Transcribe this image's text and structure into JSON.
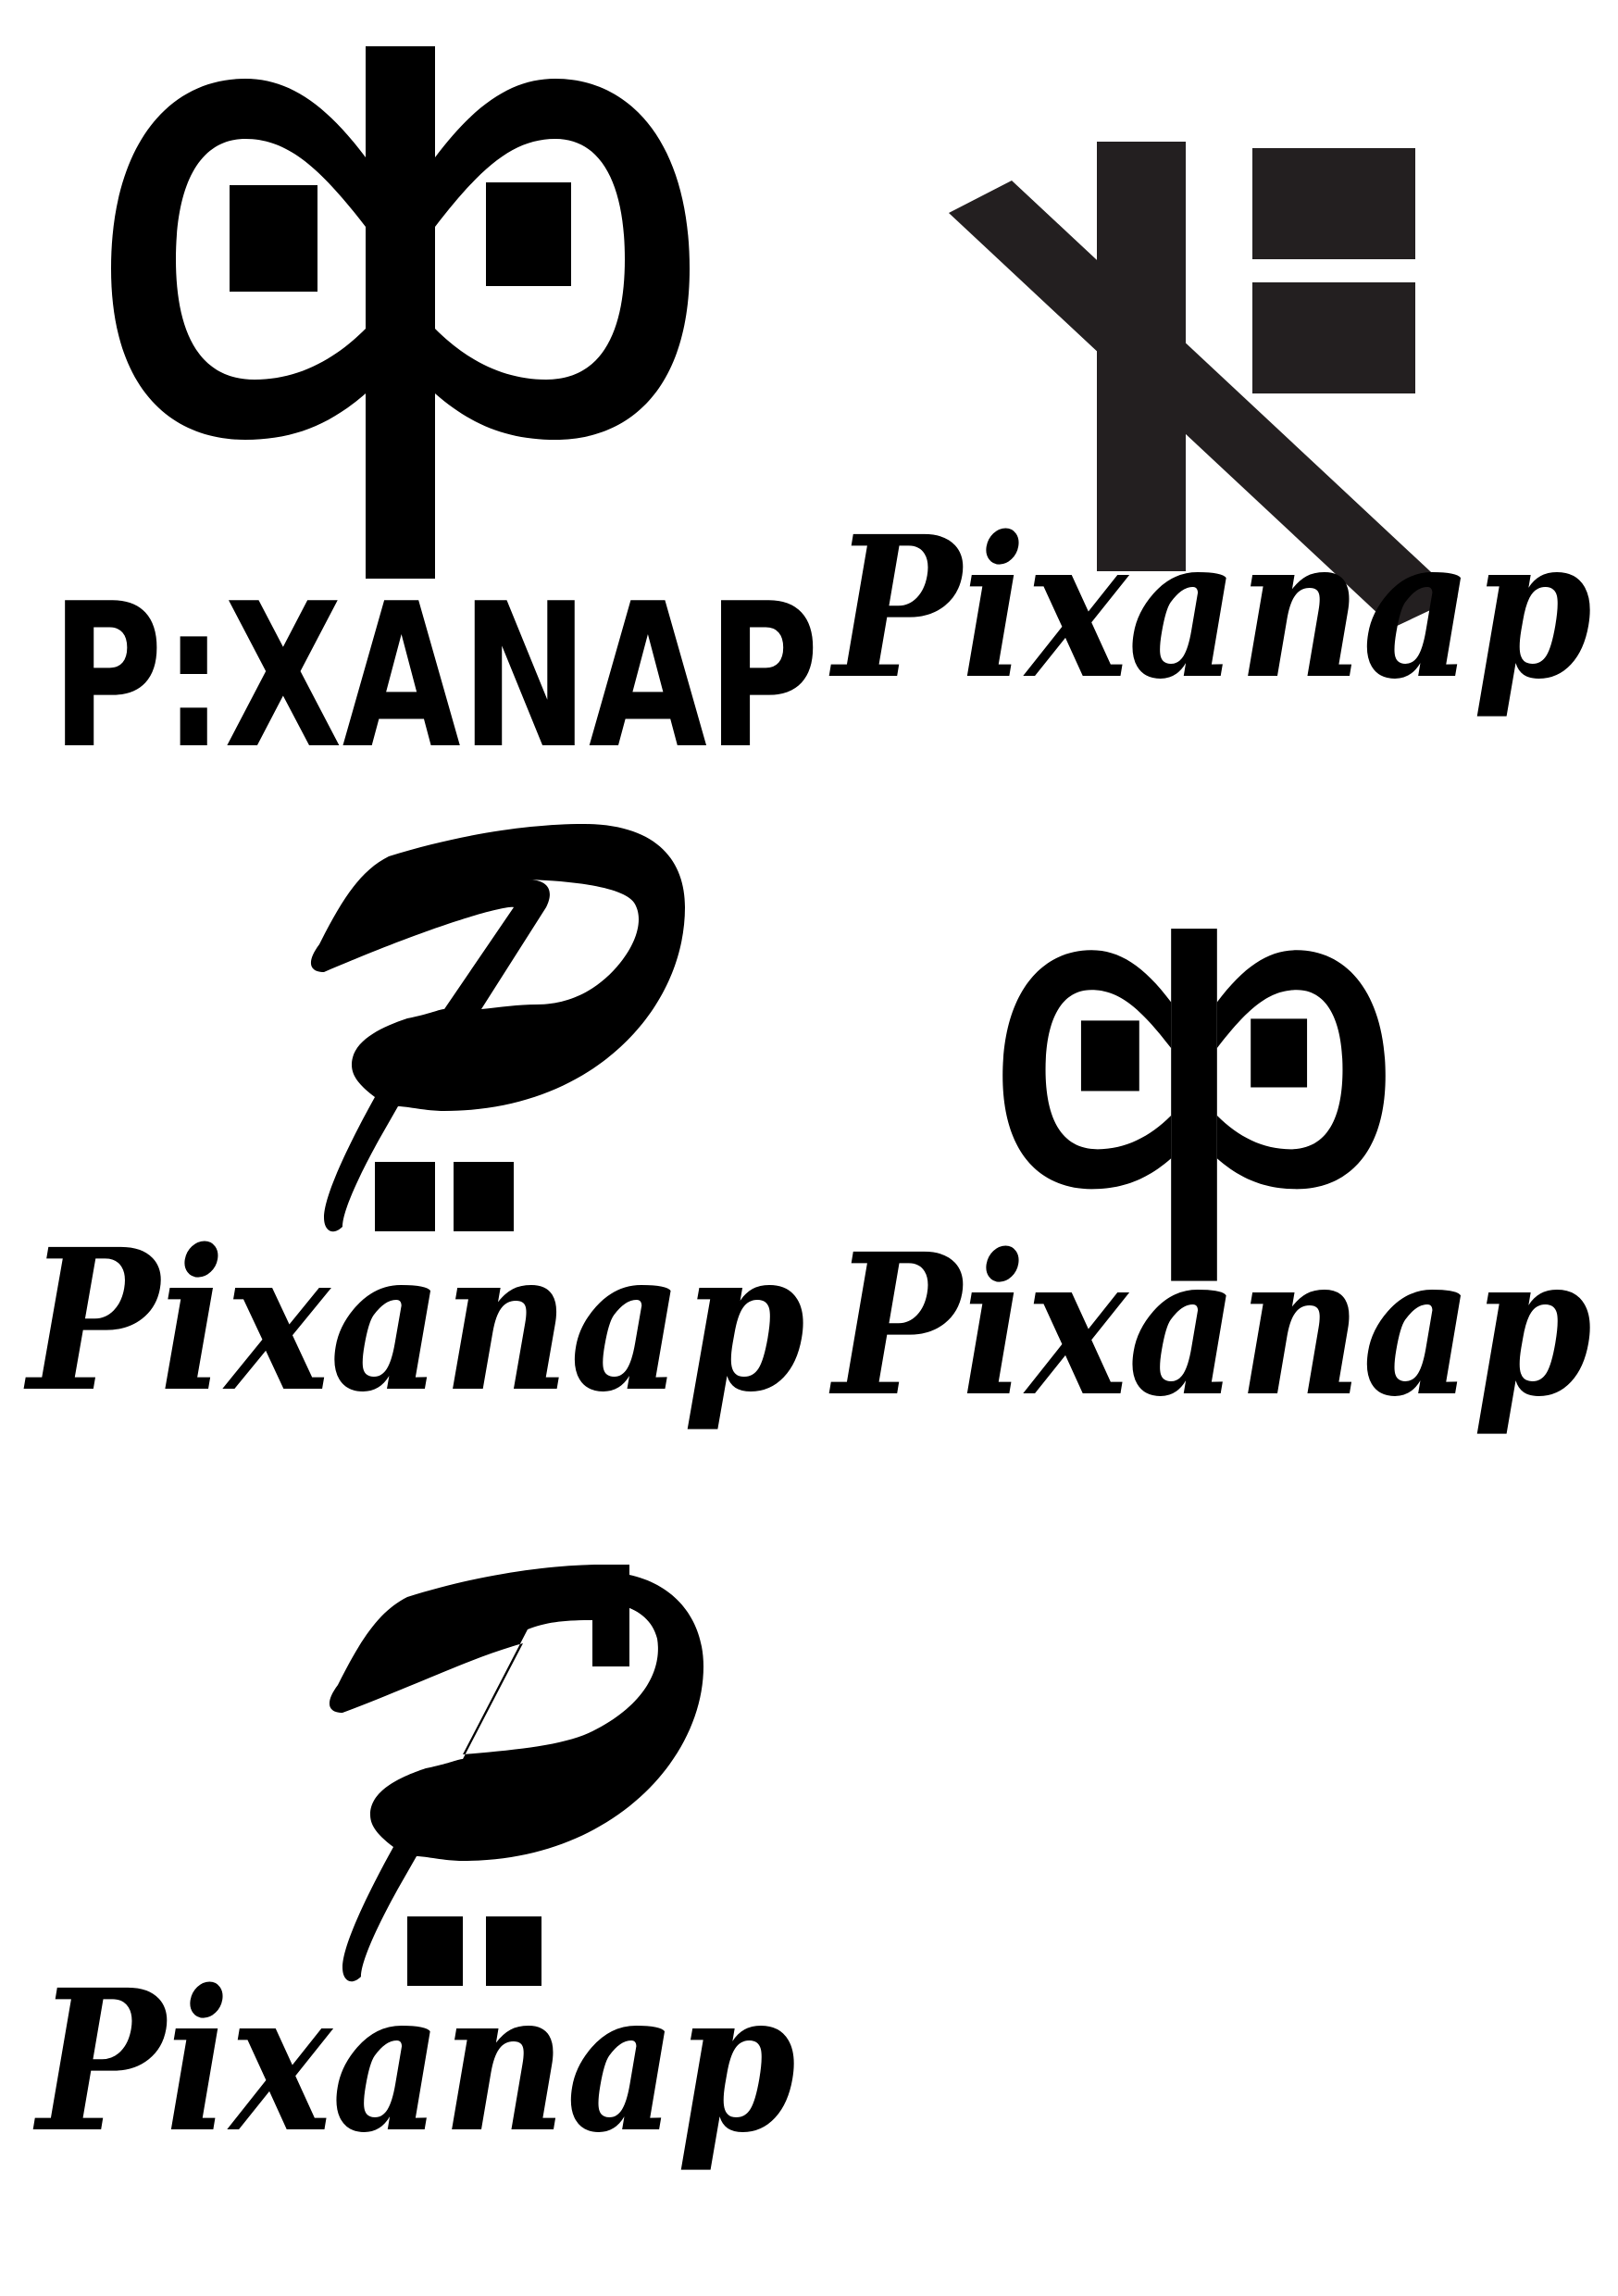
{
  "sheet": {
    "background": "#ffffff",
    "ink": "#000000",
    "ink_alt": "#231f20"
  },
  "logos": [
    {
      "id": "phi-block-wordmark",
      "mark": "phi-symbol-with-square-eyes",
      "wordmark": "P:XANAP",
      "style": "block"
    },
    {
      "id": "kh-script-wordmark",
      "mark": "k-with-stacked-bars",
      "wordmark": "Pixanap",
      "style": "script"
    },
    {
      "id": "p-script-wordmark",
      "mark": "script-p-with-two-squares",
      "wordmark": "Pixanap",
      "style": "script"
    },
    {
      "id": "phi-script-wordmark",
      "mark": "phi-symbol-with-square-eyes",
      "wordmark": "Pixanap",
      "style": "script"
    },
    {
      "id": "p-bracket-script-wordmark",
      "mark": "script-p-with-bracket-and-two-squares",
      "wordmark": "Pixanap",
      "style": "script"
    }
  ]
}
